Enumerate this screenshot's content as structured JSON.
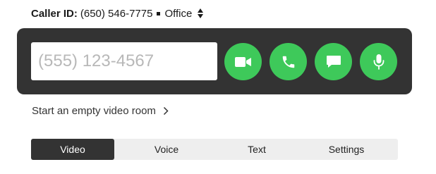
{
  "caller_id": {
    "label": "Caller ID:",
    "number": "(650) 546-7775",
    "type": "Office",
    "selector_icon": "sort-updown-icon"
  },
  "dialer": {
    "phone_placeholder": "(555) 123-4567",
    "phone_value": "",
    "buttons": [
      {
        "name": "video-call",
        "icon": "video-camera-icon"
      },
      {
        "name": "voice-call",
        "icon": "phone-icon"
      },
      {
        "name": "text-message",
        "icon": "chat-bubble-icon"
      },
      {
        "name": "voice-memo",
        "icon": "microphone-icon"
      }
    ]
  },
  "empty_room": {
    "label": "Start an empty video room",
    "icon": "chevron-right-icon"
  },
  "tabs": [
    {
      "label": "Video",
      "active": true
    },
    {
      "label": "Voice",
      "active": false
    },
    {
      "label": "Text",
      "active": false
    },
    {
      "label": "Settings",
      "active": false
    }
  ],
  "colors": {
    "panel": "#333333",
    "accent_green": "#3ec95a",
    "tab_bar": "#eeeeee",
    "tab_active": "#333333"
  }
}
